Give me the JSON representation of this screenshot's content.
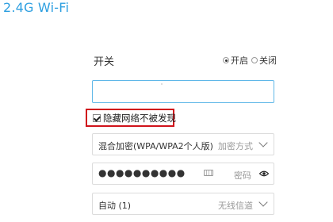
{
  "header": {
    "title": "2.4G Wi-Fi"
  },
  "switch": {
    "label": "开关",
    "options": [
      {
        "label": "开启",
        "checked": true
      },
      {
        "label": "关闭",
        "checked": false
      }
    ]
  },
  "ssid": {
    "value": "",
    "placeholder": ""
  },
  "hide_ssid": {
    "label": "隐藏网络不被发现",
    "checked": true,
    "highlight_color": "#d0121b"
  },
  "encryption": {
    "value": "混合加密(WPA/WPA2个人版)",
    "hint": "加密方式"
  },
  "password": {
    "value": "●●●●●●●●●●",
    "hint": "密码"
  },
  "channel": {
    "value": "自动 (1)",
    "hint": "无线信道"
  },
  "colors": {
    "accent": "#2d9fe0",
    "input_focus": "#5fb7e8"
  }
}
